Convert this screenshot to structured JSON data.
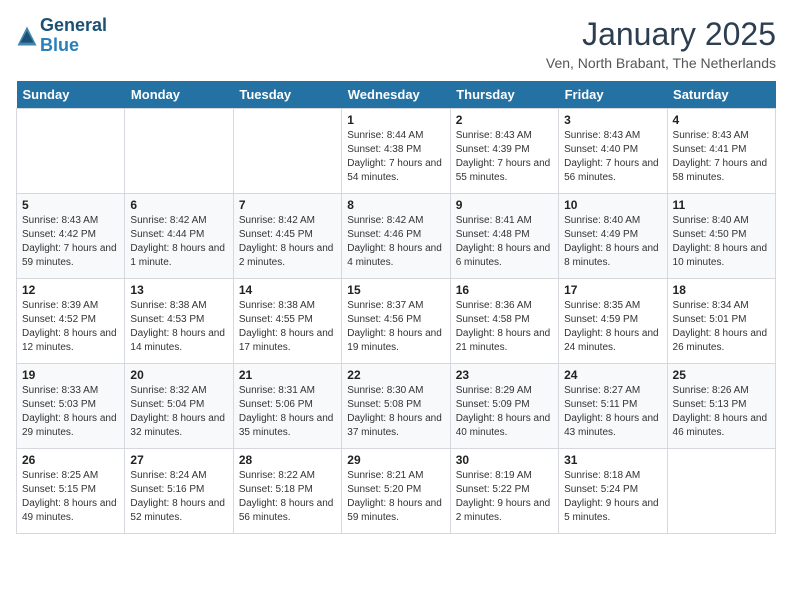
{
  "header": {
    "logo_line1": "General",
    "logo_line2": "Blue",
    "month": "January 2025",
    "location": "Ven, North Brabant, The Netherlands"
  },
  "days_of_week": [
    "Sunday",
    "Monday",
    "Tuesday",
    "Wednesday",
    "Thursday",
    "Friday",
    "Saturday"
  ],
  "weeks": [
    [
      {
        "day": "",
        "sunrise": "",
        "sunset": "",
        "daylight": ""
      },
      {
        "day": "",
        "sunrise": "",
        "sunset": "",
        "daylight": ""
      },
      {
        "day": "",
        "sunrise": "",
        "sunset": "",
        "daylight": ""
      },
      {
        "day": "1",
        "sunrise": "Sunrise: 8:44 AM",
        "sunset": "Sunset: 4:38 PM",
        "daylight": "Daylight: 7 hours and 54 minutes."
      },
      {
        "day": "2",
        "sunrise": "Sunrise: 8:43 AM",
        "sunset": "Sunset: 4:39 PM",
        "daylight": "Daylight: 7 hours and 55 minutes."
      },
      {
        "day": "3",
        "sunrise": "Sunrise: 8:43 AM",
        "sunset": "Sunset: 4:40 PM",
        "daylight": "Daylight: 7 hours and 56 minutes."
      },
      {
        "day": "4",
        "sunrise": "Sunrise: 8:43 AM",
        "sunset": "Sunset: 4:41 PM",
        "daylight": "Daylight: 7 hours and 58 minutes."
      }
    ],
    [
      {
        "day": "5",
        "sunrise": "Sunrise: 8:43 AM",
        "sunset": "Sunset: 4:42 PM",
        "daylight": "Daylight: 7 hours and 59 minutes."
      },
      {
        "day": "6",
        "sunrise": "Sunrise: 8:42 AM",
        "sunset": "Sunset: 4:44 PM",
        "daylight": "Daylight: 8 hours and 1 minute."
      },
      {
        "day": "7",
        "sunrise": "Sunrise: 8:42 AM",
        "sunset": "Sunset: 4:45 PM",
        "daylight": "Daylight: 8 hours and 2 minutes."
      },
      {
        "day": "8",
        "sunrise": "Sunrise: 8:42 AM",
        "sunset": "Sunset: 4:46 PM",
        "daylight": "Daylight: 8 hours and 4 minutes."
      },
      {
        "day": "9",
        "sunrise": "Sunrise: 8:41 AM",
        "sunset": "Sunset: 4:48 PM",
        "daylight": "Daylight: 8 hours and 6 minutes."
      },
      {
        "day": "10",
        "sunrise": "Sunrise: 8:40 AM",
        "sunset": "Sunset: 4:49 PM",
        "daylight": "Daylight: 8 hours and 8 minutes."
      },
      {
        "day": "11",
        "sunrise": "Sunrise: 8:40 AM",
        "sunset": "Sunset: 4:50 PM",
        "daylight": "Daylight: 8 hours and 10 minutes."
      }
    ],
    [
      {
        "day": "12",
        "sunrise": "Sunrise: 8:39 AM",
        "sunset": "Sunset: 4:52 PM",
        "daylight": "Daylight: 8 hours and 12 minutes."
      },
      {
        "day": "13",
        "sunrise": "Sunrise: 8:38 AM",
        "sunset": "Sunset: 4:53 PM",
        "daylight": "Daylight: 8 hours and 14 minutes."
      },
      {
        "day": "14",
        "sunrise": "Sunrise: 8:38 AM",
        "sunset": "Sunset: 4:55 PM",
        "daylight": "Daylight: 8 hours and 17 minutes."
      },
      {
        "day": "15",
        "sunrise": "Sunrise: 8:37 AM",
        "sunset": "Sunset: 4:56 PM",
        "daylight": "Daylight: 8 hours and 19 minutes."
      },
      {
        "day": "16",
        "sunrise": "Sunrise: 8:36 AM",
        "sunset": "Sunset: 4:58 PM",
        "daylight": "Daylight: 8 hours and 21 minutes."
      },
      {
        "day": "17",
        "sunrise": "Sunrise: 8:35 AM",
        "sunset": "Sunset: 4:59 PM",
        "daylight": "Daylight: 8 hours and 24 minutes."
      },
      {
        "day": "18",
        "sunrise": "Sunrise: 8:34 AM",
        "sunset": "Sunset: 5:01 PM",
        "daylight": "Daylight: 8 hours and 26 minutes."
      }
    ],
    [
      {
        "day": "19",
        "sunrise": "Sunrise: 8:33 AM",
        "sunset": "Sunset: 5:03 PM",
        "daylight": "Daylight: 8 hours and 29 minutes."
      },
      {
        "day": "20",
        "sunrise": "Sunrise: 8:32 AM",
        "sunset": "Sunset: 5:04 PM",
        "daylight": "Daylight: 8 hours and 32 minutes."
      },
      {
        "day": "21",
        "sunrise": "Sunrise: 8:31 AM",
        "sunset": "Sunset: 5:06 PM",
        "daylight": "Daylight: 8 hours and 35 minutes."
      },
      {
        "day": "22",
        "sunrise": "Sunrise: 8:30 AM",
        "sunset": "Sunset: 5:08 PM",
        "daylight": "Daylight: 8 hours and 37 minutes."
      },
      {
        "day": "23",
        "sunrise": "Sunrise: 8:29 AM",
        "sunset": "Sunset: 5:09 PM",
        "daylight": "Daylight: 8 hours and 40 minutes."
      },
      {
        "day": "24",
        "sunrise": "Sunrise: 8:27 AM",
        "sunset": "Sunset: 5:11 PM",
        "daylight": "Daylight: 8 hours and 43 minutes."
      },
      {
        "day": "25",
        "sunrise": "Sunrise: 8:26 AM",
        "sunset": "Sunset: 5:13 PM",
        "daylight": "Daylight: 8 hours and 46 minutes."
      }
    ],
    [
      {
        "day": "26",
        "sunrise": "Sunrise: 8:25 AM",
        "sunset": "Sunset: 5:15 PM",
        "daylight": "Daylight: 8 hours and 49 minutes."
      },
      {
        "day": "27",
        "sunrise": "Sunrise: 8:24 AM",
        "sunset": "Sunset: 5:16 PM",
        "daylight": "Daylight: 8 hours and 52 minutes."
      },
      {
        "day": "28",
        "sunrise": "Sunrise: 8:22 AM",
        "sunset": "Sunset: 5:18 PM",
        "daylight": "Daylight: 8 hours and 56 minutes."
      },
      {
        "day": "29",
        "sunrise": "Sunrise: 8:21 AM",
        "sunset": "Sunset: 5:20 PM",
        "daylight": "Daylight: 8 hours and 59 minutes."
      },
      {
        "day": "30",
        "sunrise": "Sunrise: 8:19 AM",
        "sunset": "Sunset: 5:22 PM",
        "daylight": "Daylight: 9 hours and 2 minutes."
      },
      {
        "day": "31",
        "sunrise": "Sunrise: 8:18 AM",
        "sunset": "Sunset: 5:24 PM",
        "daylight": "Daylight: 9 hours and 5 minutes."
      },
      {
        "day": "",
        "sunrise": "",
        "sunset": "",
        "daylight": ""
      }
    ]
  ]
}
